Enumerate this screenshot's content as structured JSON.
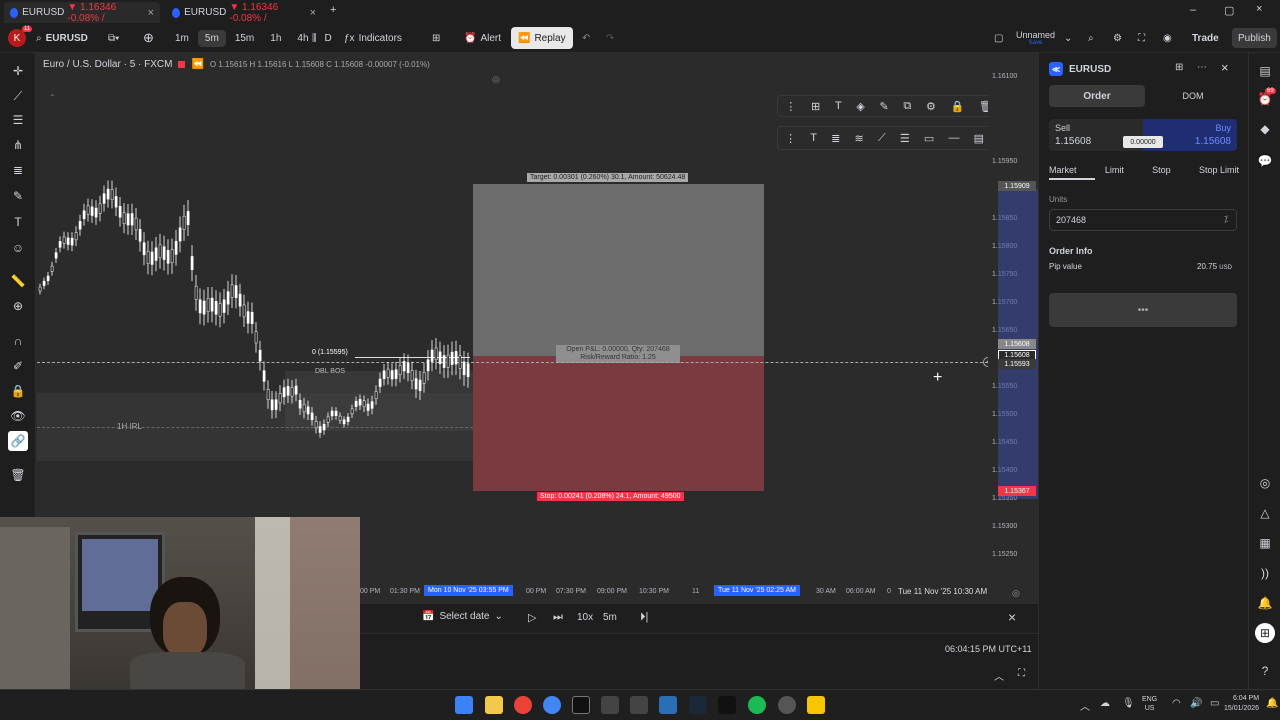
{
  "browser_tabs": [
    {
      "label": "EURUSD",
      "change": "▼ 1.16346 -0.08% /"
    },
    {
      "label": "EURUSD",
      "change": "▼ 1.16346 -0.08% /"
    }
  ],
  "toolbar": {
    "avatar_letter": "K",
    "avatar_badge": "11",
    "symbol": "EURUSD",
    "intervals": [
      "1m",
      "5m",
      "15m",
      "1h",
      "4h",
      "D"
    ],
    "active_interval": "5m",
    "indicators_label": "Indicators",
    "alert_label": "Alert",
    "replay_label": "Replay",
    "layout_name": "Unnamed",
    "layout_sub": "Save",
    "trade_label": "Trade",
    "publish_label": "Publish"
  },
  "chart_header": {
    "title": "Euro / U.S. Dollar · 5 · FXCM",
    "ohlc": "O 1.15615 H 1.15616 L 1.15608 C 1.15608 -0.00007 (-0.01%)"
  },
  "position_tool": {
    "target_label": "Target: 0.00301 (0.260%) 30.1, Amount: 50624.48",
    "open_label_1": "Open P&L: 0.00000, Qty: 207468",
    "open_label_2": "Risk/Reward Ratio: 1.25",
    "stop_label": "Stop: 0.00241 (0.208%) 24.1, Amount: 49500"
  },
  "chart_annotations": {
    "level_label": "0 (1.15595)",
    "dbl_bos": "DBL BOS",
    "irl_1h": "1H IRL"
  },
  "price_axis": {
    "ticks": [
      "1.16100",
      "1.15950",
      "1.15850",
      "1.15800",
      "1.15750",
      "1.15700",
      "1.15650",
      "1.15550",
      "1.15500",
      "1.15450",
      "1.15400",
      "1.15350",
      "1.15300",
      "1.15250"
    ],
    "tag_target": "1.15909",
    "tag_current": "1.15608",
    "tag_current2": "1.15608",
    "tag_mid": "1.15593",
    "tag_stop": "1.15367"
  },
  "time_axis": {
    "labels": [
      "00 PM",
      "01:30 PM",
      "00 PM",
      "07:30 PM",
      "09:00 PM",
      "10:30 PM",
      "11",
      "30 AM",
      "06:00 AM",
      "0"
    ],
    "highlight_1": "Mon 10 Nov '25  03:55 PM",
    "highlight_2": "Tue 11 Nov '25  02:25 AM",
    "end_label": "Tue 11 Nov '25  10:30 AM"
  },
  "replay_bar": {
    "select_date": "Select date",
    "speed": "10x",
    "interval": "5m"
  },
  "status_bar": {
    "clock": "06:04:15 PM UTC+11"
  },
  "order_panel": {
    "symbol": "EURUSD",
    "tab_order": "Order",
    "tab_dom": "DOM",
    "sell_label": "Sell",
    "sell_price": "1.15608",
    "spread": "0.00000",
    "buy_label": "Buy",
    "buy_price": "1.15608",
    "order_types": [
      "Market",
      "Limit",
      "Stop",
      "Stop Limit"
    ],
    "units_label": "Units",
    "units_value": "207468",
    "order_info_label": "Order Info",
    "pip_value_label": "Pip value",
    "pip_value": "20.75",
    "pip_unit": "USD"
  },
  "far_right": {
    "badge": "69"
  },
  "taskbar": {
    "lang_1": "ENG",
    "lang_2": "US",
    "time": "6:04 PM",
    "date": "15/01/2026"
  },
  "colors": {
    "target_zone": "#6d6d6d",
    "stop_zone": "#7a3b40",
    "accent": "#2962ff",
    "red": "#f23645"
  }
}
